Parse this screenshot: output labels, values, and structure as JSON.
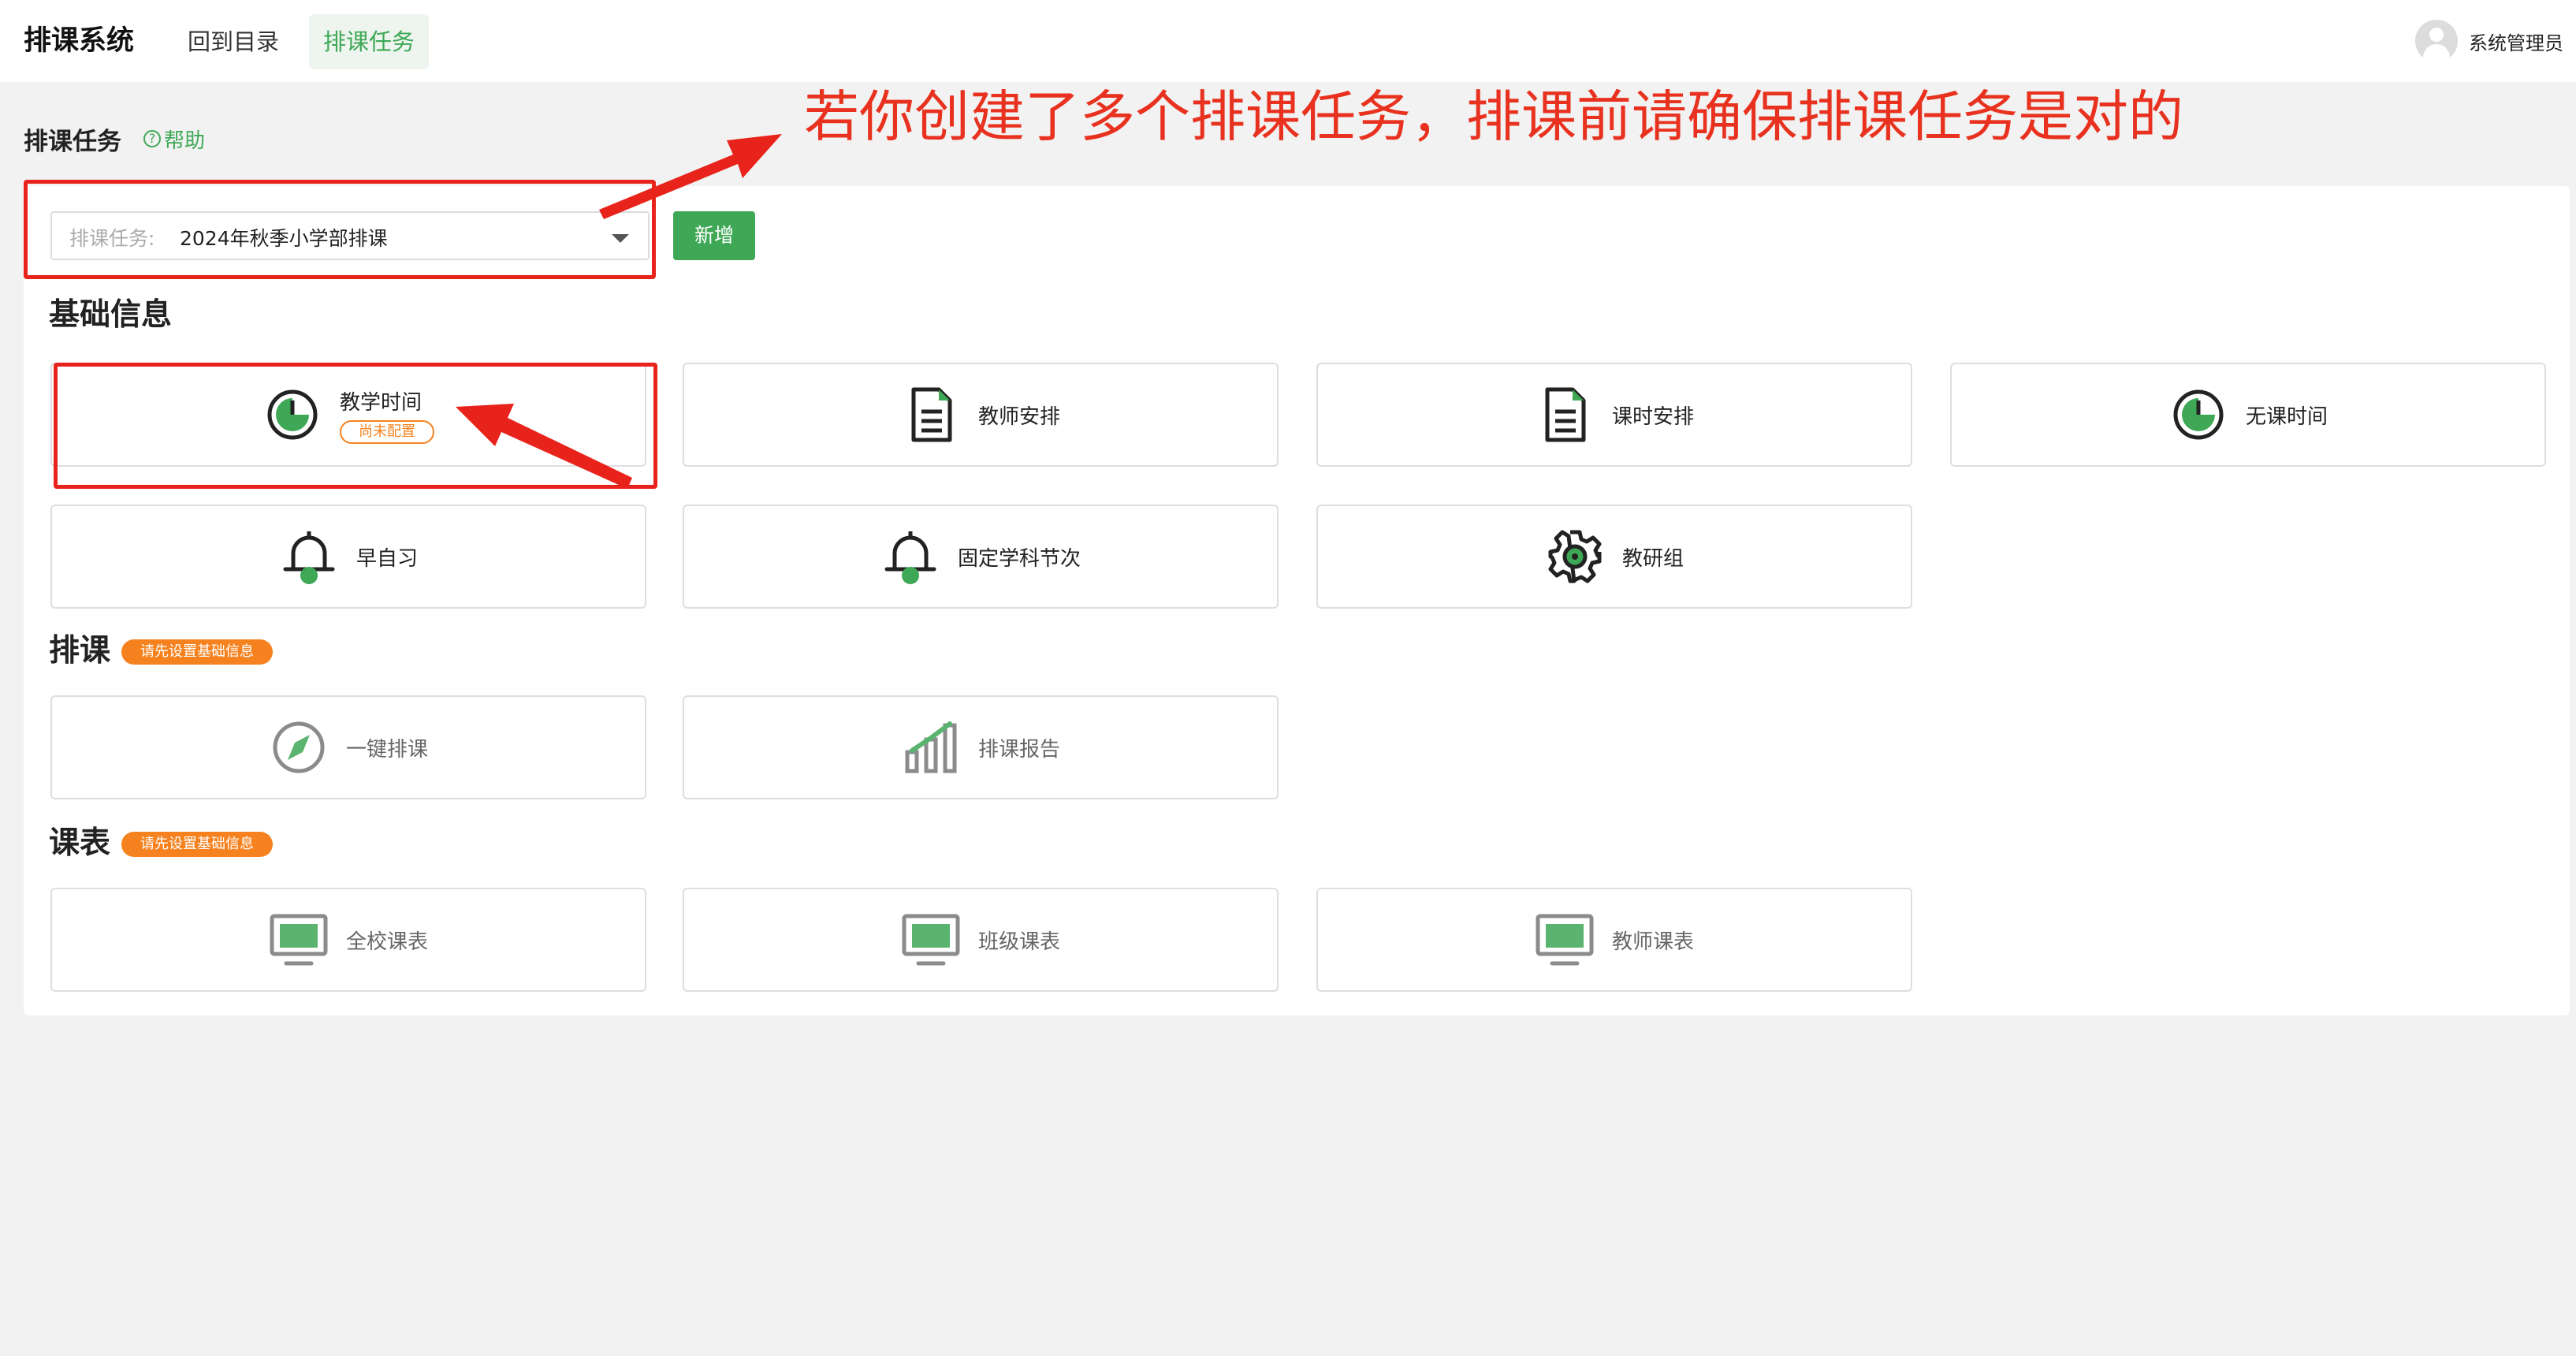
{
  "app": {
    "title": "排课系统"
  },
  "nav": {
    "home": "回到目录",
    "task": "排课任务"
  },
  "user": {
    "name": "系统管理员"
  },
  "section": {
    "title": "排课任务",
    "help": "帮助"
  },
  "annotation": "若你创建了多个排课任务，排课前请确保排课任务是对的",
  "selector": {
    "label": "排课任务:",
    "value": "2024年秋季小学部排课",
    "add_label": "新增"
  },
  "groups": {
    "basic": {
      "title": "基础信息",
      "cards": [
        {
          "label": "教学时间",
          "status": "尚未配置",
          "icon": "clock-icon"
        },
        {
          "label": "教师安排",
          "icon": "document-icon"
        },
        {
          "label": "课时安排",
          "icon": "document-icon"
        },
        {
          "label": "无课时间",
          "icon": "clock-icon"
        },
        {
          "label": "早自习",
          "icon": "bell-icon"
        },
        {
          "label": "固定学科节次",
          "icon": "bell-icon"
        },
        {
          "label": "教研组",
          "icon": "gear-icon"
        }
      ]
    },
    "schedule": {
      "title": "排课",
      "badge": "请先设置基础信息",
      "cards": [
        {
          "label": "一键排课",
          "icon": "compass-icon"
        },
        {
          "label": "排课报告",
          "icon": "bar-chart-icon"
        }
      ]
    },
    "timetable": {
      "title": "课表",
      "badge": "请先设置基础信息",
      "cards": [
        {
          "label": "全校课表",
          "icon": "monitor-icon"
        },
        {
          "label": "班级课表",
          "icon": "monitor-icon"
        },
        {
          "label": "教师课表",
          "icon": "monitor-icon"
        }
      ]
    }
  },
  "colors": {
    "accent": "#3ea856",
    "warning": "#f5821f",
    "annotation": "#e8321f"
  }
}
